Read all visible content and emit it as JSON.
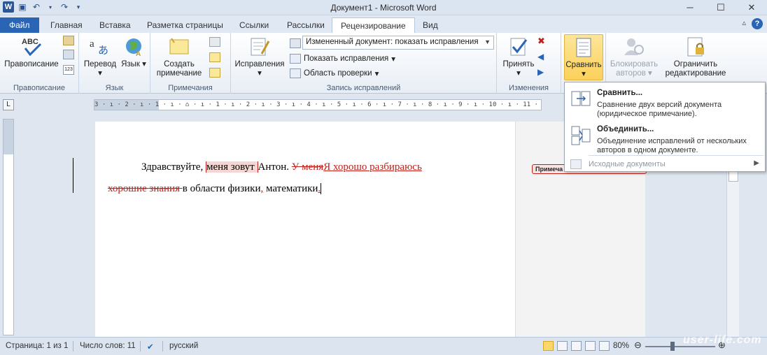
{
  "window": {
    "title": "Документ1 - Microsoft Word",
    "minimize": "─",
    "maximize": "☐",
    "close": "✕"
  },
  "tabs": [
    {
      "label": "Файл"
    },
    {
      "label": "Главная"
    },
    {
      "label": "Вставка"
    },
    {
      "label": "Разметка страницы"
    },
    {
      "label": "Ссылки"
    },
    {
      "label": "Рассылки"
    },
    {
      "label": "Рецензирование"
    },
    {
      "label": "Вид"
    }
  ],
  "ribbon": {
    "groups": {
      "proofing": {
        "label": "Правописание",
        "spelling": "Правописание"
      },
      "language": {
        "label": "Язык",
        "translate": "Перевод",
        "language": "Язык"
      },
      "comments": {
        "label": "Примечания",
        "new_comment_line1": "Создать",
        "new_comment_line2": "примечание"
      },
      "tracking": {
        "label": "Запись исправлений",
        "track_changes": "Исправления",
        "display_mode": "Измененный документ: показать исправления",
        "show_markup": "Показать исправления",
        "reviewing_pane": "Область проверки"
      },
      "changes": {
        "label": "Изменения",
        "accept": "Принять"
      },
      "compare": {
        "compare": "Сравнить"
      },
      "protect": {
        "block_authors_line1": "Блокировать",
        "block_authors_line2": "авторов",
        "restrict_line1": "Ограничить",
        "restrict_line2": "редактирование"
      }
    }
  },
  "ruler": {
    "text": "3 · ı · 2 · ı · 1 · ı · ⌂ · ı · 1 · ı · 2 · ı · 3 · ı · 4 · ı · 5 · ı · 6 · ı · 7 · ı · 8 · ı · 9 · ı · 10 · ı · 11 · ı · 12 · ı · 13 · ı · 14 · ı · 15 · ı ·16 · ı ·17 · ı"
  },
  "document": {
    "t1": "Здравствуйте, ",
    "t2": "меня зовут ",
    "t3": "Антон. ",
    "t4": "У меня",
    "t5": "Я хорошо разбираюсь",
    "t6": " ",
    "t7": "хорошие знания ",
    "t8": "в области физики",
    "t9": ",",
    "t10": " математики",
    "t11": ".",
    "balloon": "Примеча"
  },
  "compare_menu": {
    "compare_title": "Сравнить...",
    "compare_desc": "Сравнение двух версий документа (юридическое примечание).",
    "combine_title": "Объединить...",
    "combine_desc": "Объединение исправлений от нескольких авторов в одном документе.",
    "source_docs": "Исходные документы"
  },
  "statusbar": {
    "page": "Страница: 1 из 1",
    "words": "Число слов: 11",
    "language": "русский",
    "zoom": "80%"
  },
  "watermark": "user-life.com",
  "colors": {
    "accent": "#2a64b5",
    "revision": "#c0201a",
    "pressed": "#fbd15a"
  }
}
